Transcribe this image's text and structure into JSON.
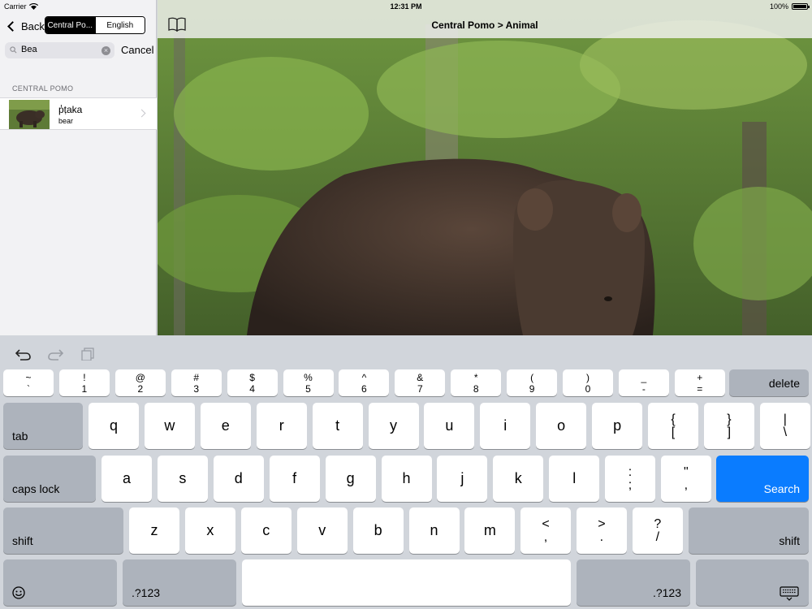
{
  "status": {
    "carrier": "Carrier",
    "time": "12:31 PM",
    "battery": "100%",
    "battery_level": 1.0
  },
  "sidebar": {
    "back_label": "Back",
    "segments": [
      "Central Po...",
      "English"
    ],
    "active_segment": 0,
    "search_value": "Bea",
    "cancel_label": "Cancel",
    "section_header": "CENTRAL POMO",
    "results": [
      {
        "word": "p̓ṭaka",
        "translation": "bear"
      }
    ]
  },
  "main": {
    "title": "Central Pomo > Animal"
  },
  "keyboard": {
    "row1": [
      {
        "top": "~",
        "bottom": "`"
      },
      {
        "top": "!",
        "bottom": "1"
      },
      {
        "top": "@",
        "bottom": "2"
      },
      {
        "top": "#",
        "bottom": "3"
      },
      {
        "top": "$",
        "bottom": "4"
      },
      {
        "top": "%",
        "bottom": "5"
      },
      {
        "top": "^",
        "bottom": "6"
      },
      {
        "top": "&",
        "bottom": "7"
      },
      {
        "top": "*",
        "bottom": "8"
      },
      {
        "top": "(",
        "bottom": "9"
      },
      {
        "top": ")",
        "bottom": "0"
      },
      {
        "top": "_",
        "bottom": "-"
      },
      {
        "top": "+",
        "bottom": "="
      }
    ],
    "delete_label": "delete",
    "tab_label": "tab",
    "row2": [
      "q",
      "w",
      "e",
      "r",
      "t",
      "y",
      "u",
      "i",
      "o",
      "p"
    ],
    "row2_sym": [
      {
        "top": "{",
        "bottom": "["
      },
      {
        "top": "}",
        "bottom": "]"
      },
      {
        "top": "|",
        "bottom": "\\"
      }
    ],
    "caps_label": "caps lock",
    "row3": [
      "a",
      "s",
      "d",
      "f",
      "g",
      "h",
      "j",
      "k",
      "l"
    ],
    "row3_sym": [
      {
        "top": ":",
        "bottom": ";"
      },
      {
        "top": "\"",
        "bottom": ","
      }
    ],
    "search_label": "Search",
    "shift_label": "shift",
    "row4": [
      "z",
      "x",
      "c",
      "v",
      "b",
      "n",
      "m"
    ],
    "row4_sym": [
      {
        "top": "<",
        "bottom": ","
      },
      {
        "top": ">",
        "bottom": "."
      },
      {
        "top": "?",
        "bottom": "/"
      }
    ],
    "numbers_label": ".?123",
    "colors": {
      "search_key": "#0a7cff",
      "key_dark": "#adb3bc",
      "background": "#d1d5db"
    }
  }
}
